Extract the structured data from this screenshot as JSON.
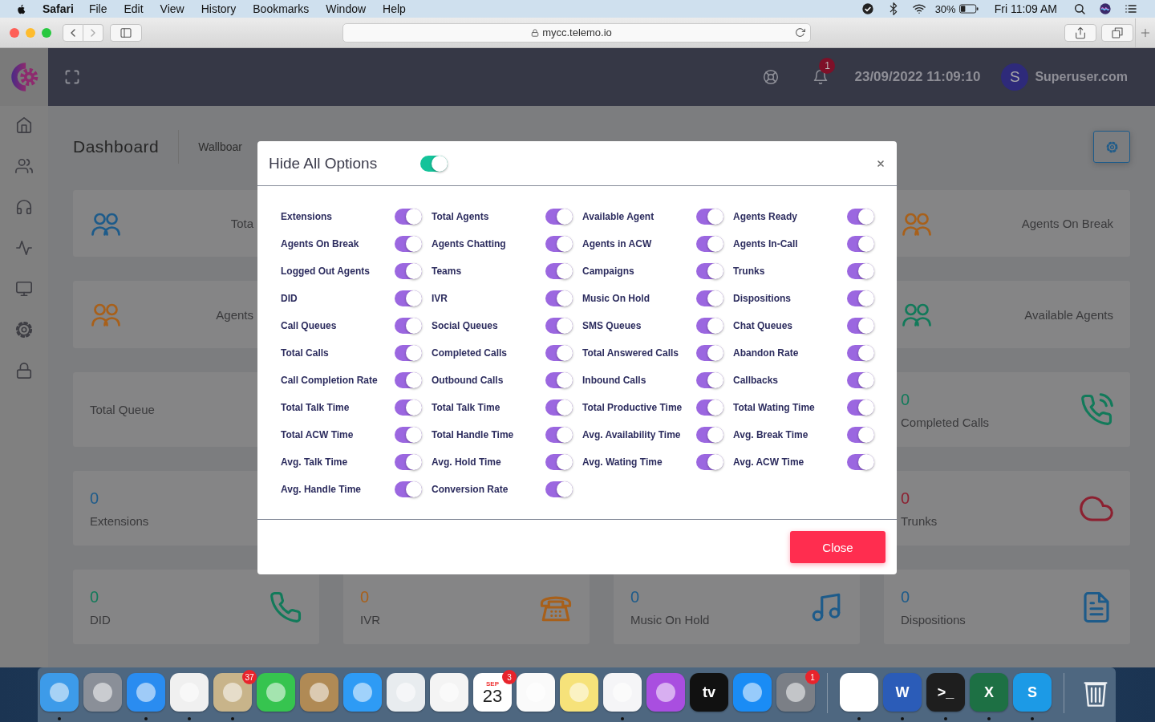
{
  "menubar": {
    "app": "Safari",
    "menus": [
      "File",
      "Edit",
      "View",
      "History",
      "Bookmarks",
      "Window",
      "Help"
    ],
    "battery": "30%",
    "clock": "Fri 11:09 AM"
  },
  "browser": {
    "url": "mycc.telemo.io"
  },
  "header": {
    "notifications": "1",
    "datetime": "23/09/2022 11:09:10",
    "avatar": "S",
    "user": "Superuser.com"
  },
  "sidebar": {
    "items": [
      {
        "kind": "home"
      },
      {
        "kind": "users"
      },
      {
        "kind": "headphones"
      },
      {
        "kind": "activity"
      },
      {
        "kind": "monitor"
      },
      {
        "kind": "settings"
      },
      {
        "kind": "lock"
      }
    ]
  },
  "page": {
    "title": "Dashboard",
    "breadcrumb": "Wallboar"
  },
  "cards": [
    [
      {
        "kind": "users",
        "color": "#1d5b8a",
        "label": "Tota"
      },
      {
        "kind": "users",
        "color": "#a8601a",
        "label": "Agents On Break"
      }
    ],
    [
      {
        "kind": "users",
        "color": "#a8601a",
        "label": "Agents"
      },
      {
        "kind": "users",
        "color": "#127a5a",
        "label": "Available Agents"
      }
    ],
    [
      {
        "kind": "label",
        "label": "Total Queue"
      },
      {
        "kind": "phone-call",
        "value": "0",
        "label": "Completed Calls",
        "color": "#127a5a"
      }
    ],
    [
      {
        "kind": "plain",
        "value": "0",
        "label": "Extensions",
        "color": "#1d5b8a"
      },
      {
        "kind": "cloud",
        "value": "0",
        "label": "Trunks",
        "color": "#8c2030"
      }
    ],
    [
      {
        "kind": "phone",
        "value": "0",
        "label": "DID",
        "color": "#127a5a"
      },
      {
        "kind": "desk-phone",
        "value": "0",
        "label": "IVR",
        "color": "#a8601a"
      },
      {
        "kind": "music",
        "value": "0",
        "label": "Music On Hold",
        "color": "#1d5b8a"
      },
      {
        "kind": "document",
        "value": "0",
        "label": "Dispositions",
        "color": "#1d5b8a"
      }
    ]
  ],
  "modal": {
    "title": "Hide All Options",
    "hide_all": true,
    "options": [
      {
        "label": "Extensions",
        "on": true
      },
      {
        "label": "Total Agents",
        "on": true
      },
      {
        "label": "Available Agent",
        "on": true
      },
      {
        "label": "Agents Ready",
        "on": true
      },
      {
        "label": "Agents On Break",
        "on": true
      },
      {
        "label": "Agents Chatting",
        "on": true
      },
      {
        "label": "Agents in ACW",
        "on": true
      },
      {
        "label": "Agents In-Call",
        "on": true
      },
      {
        "label": "Logged Out Agents",
        "on": true
      },
      {
        "label": "Teams",
        "on": true
      },
      {
        "label": "Campaigns",
        "on": true
      },
      {
        "label": "Trunks",
        "on": true
      },
      {
        "label": "DID",
        "on": true
      },
      {
        "label": "IVR",
        "on": true
      },
      {
        "label": "Music On Hold",
        "on": true
      },
      {
        "label": "Dispositions",
        "on": true
      },
      {
        "label": "Call Queues",
        "on": true
      },
      {
        "label": "Social Queues",
        "on": true
      },
      {
        "label": "SMS Queues",
        "on": true
      },
      {
        "label": "Chat Queues",
        "on": true
      },
      {
        "label": "Total Calls",
        "on": true
      },
      {
        "label": "Completed Calls",
        "on": true
      },
      {
        "label": "Total Answered Calls",
        "on": true
      },
      {
        "label": "Abandon Rate",
        "on": true
      },
      {
        "label": "Call Completion Rate",
        "on": true
      },
      {
        "label": "Outbound Calls",
        "on": true
      },
      {
        "label": "Inbound Calls",
        "on": true
      },
      {
        "label": "Callbacks",
        "on": true
      },
      {
        "label": "Total Talk Time",
        "on": true
      },
      {
        "label": "Total Talk Time",
        "on": true
      },
      {
        "label": "Total Productive Time",
        "on": true
      },
      {
        "label": "Total Wating Time",
        "on": true
      },
      {
        "label": "Total ACW Time",
        "on": true
      },
      {
        "label": "Total Handle Time",
        "on": true
      },
      {
        "label": "Avg. Availability Time",
        "on": true
      },
      {
        "label": "Avg. Break Time",
        "on": true
      },
      {
        "label": "Avg. Talk Time",
        "on": true
      },
      {
        "label": "Avg. Hold Time",
        "on": true
      },
      {
        "label": "Avg. Wating Time",
        "on": true
      },
      {
        "label": "Avg. ACW Time",
        "on": true
      },
      {
        "label": "Avg. Handle Time",
        "on": true
      },
      {
        "label": "Conversion Rate",
        "on": true
      }
    ],
    "close": "Close"
  },
  "dock": {
    "items": [
      {
        "kind": "app",
        "color": "#3d9be9",
        "running": true
      },
      {
        "kind": "app",
        "color": "#8a8f98",
        "running": false
      },
      {
        "kind": "app",
        "color": "#2a8cf0",
        "running": true
      },
      {
        "kind": "app",
        "color": "#f0f0f0",
        "running": true
      },
      {
        "kind": "app",
        "color": "#c8b48a",
        "badge": "37",
        "running": true
      },
      {
        "kind": "app",
        "color": "#36c44f",
        "running": false
      },
      {
        "kind": "app",
        "color": "#b08a55",
        "running": false
      },
      {
        "kind": "app",
        "color": "#2e9bf5",
        "running": false
      },
      {
        "kind": "app",
        "color": "#e8ecef",
        "running": false
      },
      {
        "kind": "app",
        "color": "#f4f4f4",
        "running": false
      },
      {
        "kind": "calendar",
        "color": "#ffffff",
        "month": "SEP",
        "label": "23",
        "badge": "3",
        "running": false
      },
      {
        "kind": "app",
        "color": "#fafafa",
        "running": false
      },
      {
        "kind": "app",
        "color": "#f6e27a",
        "running": false
      },
      {
        "kind": "app",
        "color": "#f5f5f7",
        "running": true
      },
      {
        "kind": "app",
        "color": "#a94ee0",
        "running": false
      },
      {
        "kind": "app",
        "color": "#111111",
        "label": "tv",
        "running": false
      },
      {
        "kind": "app",
        "color": "#1a8cf5",
        "running": false
      },
      {
        "kind": "app",
        "color": "#7b7f86",
        "badge": "1",
        "running": false
      },
      {
        "kind": "divider"
      },
      {
        "kind": "app",
        "color": "#ffffff",
        "running": true
      },
      {
        "kind": "app",
        "color": "#2b5cb8",
        "label": "W",
        "running": true
      },
      {
        "kind": "app",
        "color": "#1e1e1e",
        "label": ">_",
        "running": true
      },
      {
        "kind": "app",
        "color": "#1d7044",
        "label": "X",
        "running": true
      },
      {
        "kind": "app",
        "color": "#1c9ae6",
        "label": "S",
        "running": true
      },
      {
        "kind": "divider"
      },
      {
        "kind": "trash",
        "running": false
      }
    ]
  }
}
